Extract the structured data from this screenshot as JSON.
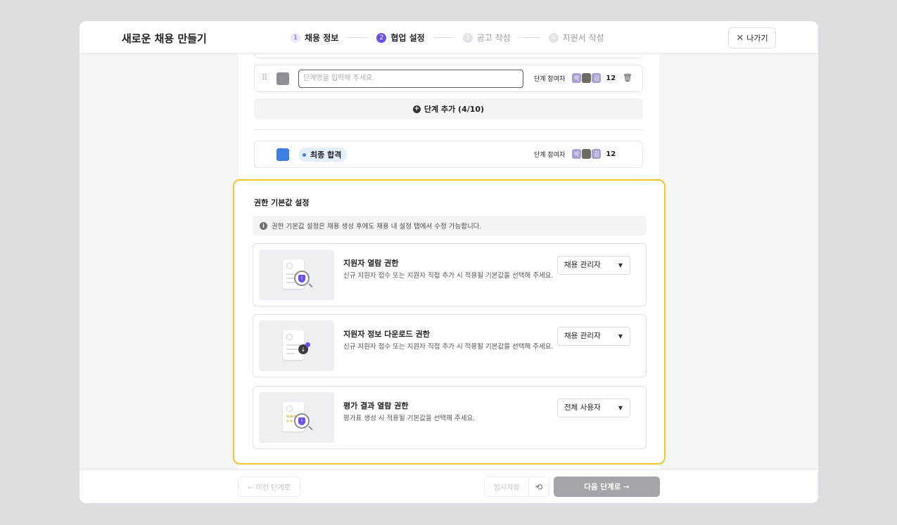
{
  "header": {
    "title": "새로운 채용 만들기",
    "steps": [
      {
        "num": "1",
        "label": "채용 정보"
      },
      {
        "num": "2",
        "label": "협업 설정"
      },
      {
        "num": "3",
        "label": "공고 작성"
      },
      {
        "num": "4",
        "label": "지원서 작성"
      }
    ],
    "exit_icon": "close-icon",
    "exit_label": "나가기"
  },
  "stages": {
    "input_placeholder": "단계명을 입력해 주세요.",
    "input_color": "#8e9096",
    "participants_label": "단계 참여자",
    "avatars": [
      "박",
      "",
      "김"
    ],
    "count": "12",
    "add_label": "단계 추가 (4/10)",
    "final_stage": {
      "label": "최종 합격",
      "color": "#3d82e0",
      "participants_label": "단계 참여자",
      "count": "12"
    }
  },
  "permissions": {
    "title": "권한 기본값 설정",
    "info": "권한 기본값 설정은 채용 생성 후에도 채용 내 설정 탭에서 수정 가능합니다.",
    "items": [
      {
        "title": "지원자 열람 권한",
        "desc": "신규 지원자 접수 또는 지원자 직접 추가 시 적용될 기본값을 선택해 주세요.",
        "value": "채용 관리자",
        "icon": "applicant-view-icon"
      },
      {
        "title": "지원자 정보 다운로드 권한",
        "desc": "신규 지원자 접수 또는 지원자 직접 추가 시 적용될 기본값을 선택해 주세요.",
        "value": "채용 관리자",
        "icon": "applicant-download-icon"
      },
      {
        "title": "평가 결과 열람 권한",
        "desc": "평가표 생성 시 적용될 기본값을 선택해 주세요.",
        "value": "전체 사용자",
        "icon": "evaluation-view-icon"
      }
    ],
    "highlight_color": "#f1c62f"
  },
  "footer": {
    "prev_label": "← 이전 단계로",
    "save_label": "임시저장",
    "next_label": "다음 단계로 →"
  },
  "colors": {
    "accent": "#6e4ef0",
    "next_disabled": "#a3a5aa"
  }
}
